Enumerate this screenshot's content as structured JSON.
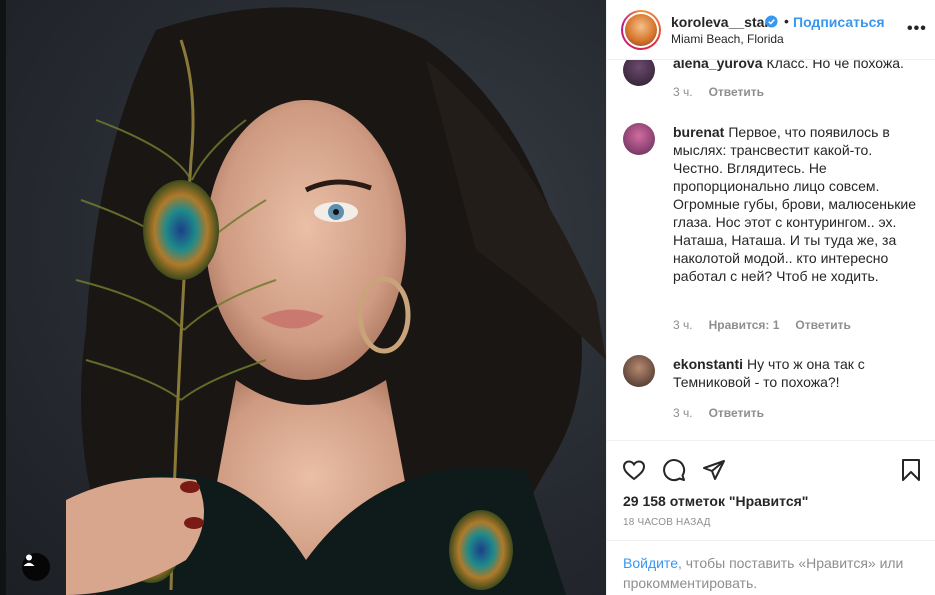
{
  "post": {
    "tag_button_icon": "user-tag-icon"
  },
  "header": {
    "username": "koroleva__star",
    "verified_icon": "verified-badge-icon",
    "separator": "•",
    "follow_label": "Подписаться",
    "location": "Miami Beach, Florida",
    "more_label": "•••"
  },
  "comments": [
    {
      "user": "alena_yurova",
      "text": "Класс. Но чё похожа.",
      "time": "3 ч.",
      "likes": "",
      "reply": "Ответить"
    },
    {
      "user": "burenat",
      "text": "Первое, что появилось в мыслях: трансвестит какой-то. Честно. Вглядитесь. Не пропорционально лицо совсем. Огромные губы, брови, малюсенькие глаза. Нос этот с контурингом.. эх. Наташа, Наташа. И ты туда же, за наколотой модой.. кто интересно работал с ней? Чтоб не ходить.",
      "time": "3 ч.",
      "likes": "Нравится: 1",
      "reply": "Ответить"
    },
    {
      "user": "ekonstanti",
      "text": "Ну что ж она так с Темниковой - то похожа?!",
      "time": "3 ч.",
      "likes": "",
      "reply": "Ответить"
    }
  ],
  "actions": {
    "like_icon": "heart-icon",
    "comment_icon": "comment-icon",
    "share_icon": "share-icon",
    "save_icon": "bookmark-icon",
    "likes_text": "29 158 отметок \"Нравится\"",
    "time_ago": "18 часов назад",
    "login_link": "Войдите",
    "login_rest": ", чтобы поставить «Нравится» или прокомментировать."
  },
  "colors": {
    "link_blue": "#3897f0",
    "text": "#262626",
    "muted": "#8e8e8e",
    "border": "#efefef"
  }
}
